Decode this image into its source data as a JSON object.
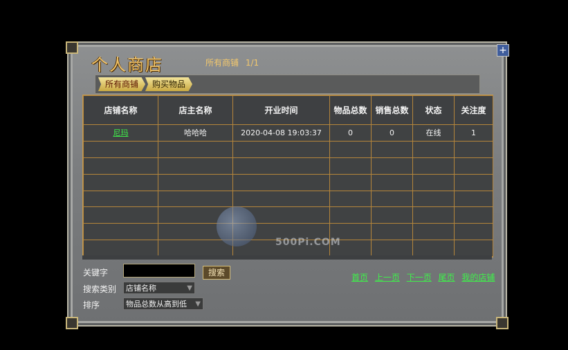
{
  "window": {
    "title": "个人商店",
    "subtitle_label": "所有商铺",
    "page_indicator": "1/1"
  },
  "tabs": [
    {
      "label": "所有商铺"
    },
    {
      "label": "购买物品"
    }
  ],
  "table": {
    "headers": [
      "店铺名称",
      "店主名称",
      "开业时间",
      "物品总数",
      "销售总数",
      "状态",
      "关注度"
    ],
    "rows": [
      [
        "尼玛",
        "哈哈哈",
        "2020-04-08 19:03:37",
        "0",
        "0",
        "在线",
        "1"
      ]
    ]
  },
  "watermark": {
    "sub": "500Pi.COM"
  },
  "filters": {
    "keyword_label": "关键字",
    "keyword_value": "",
    "search_label": "搜索",
    "type_label": "搜索类别",
    "type_value": "店铺名称",
    "sort_label": "排序",
    "sort_value": "物品总数从高到低"
  },
  "pager": {
    "first": "首页",
    "prev": "上一页",
    "next": "下一页",
    "last": "尾页",
    "mine": "我的店铺"
  }
}
